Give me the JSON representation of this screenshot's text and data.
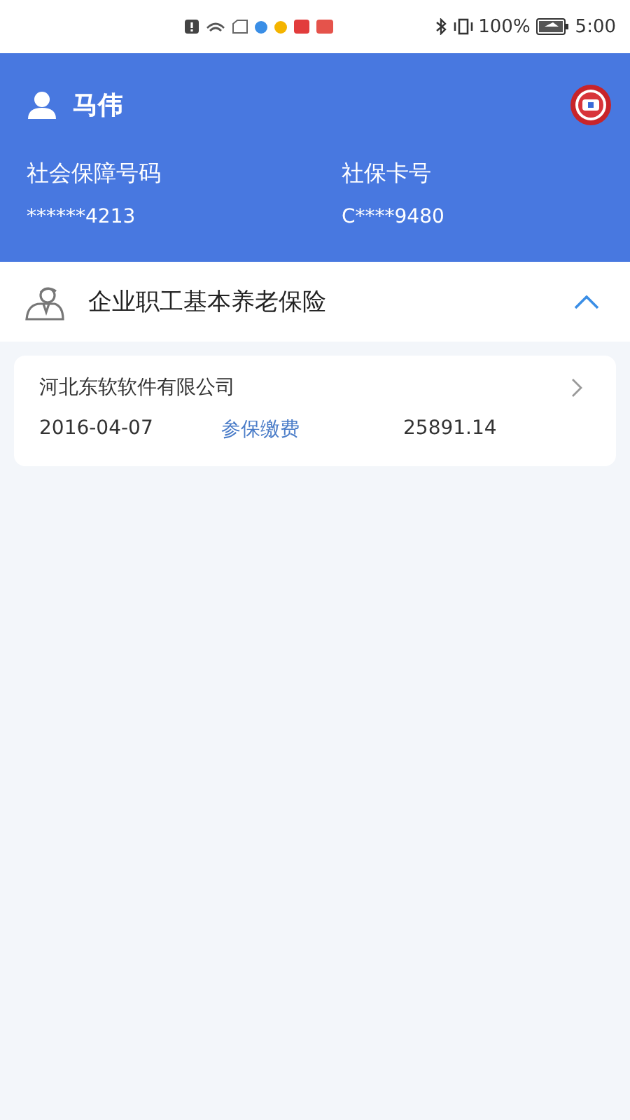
{
  "status_bar": {
    "battery": "100%",
    "time": "5:00"
  },
  "profile": {
    "name": "马伟",
    "fields": [
      {
        "label": "社会保障号码",
        "value": "******4213"
      },
      {
        "label": "社保卡号",
        "value": "C****9480"
      }
    ]
  },
  "insurance": {
    "title": "企业职工基本养老保险",
    "expanded": true,
    "records": [
      {
        "company": "河北东软软件有限公司",
        "date": "2016-04-07",
        "status": "参保缴费",
        "amount": "25891.14"
      }
    ]
  }
}
